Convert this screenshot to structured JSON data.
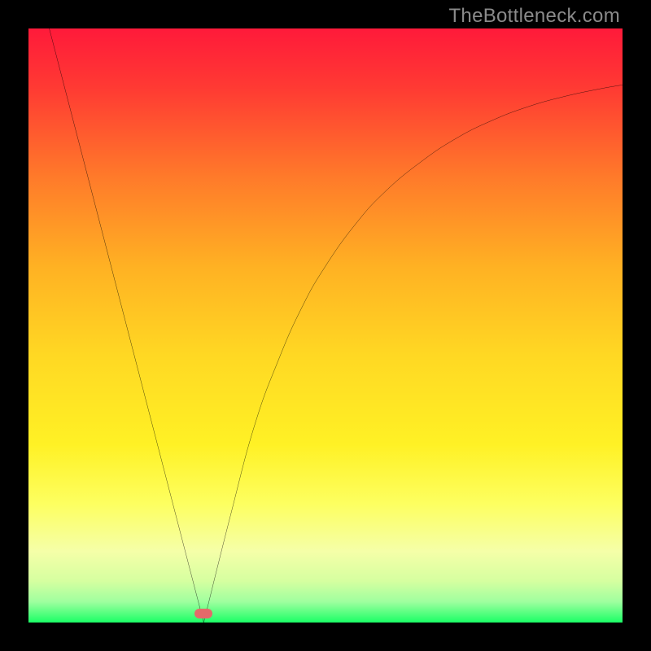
{
  "watermark": "TheBottleneck.com",
  "marker_color": "#e46a6a",
  "chart_data": {
    "type": "line",
    "title": "",
    "xlabel": "",
    "ylabel": "",
    "xlim": [
      0,
      100
    ],
    "ylim": [
      0,
      100
    ],
    "grid": false,
    "legend": false,
    "gradient_stops": [
      {
        "pos": 0.0,
        "color": "#ff1a3a"
      },
      {
        "pos": 0.1,
        "color": "#ff3a33"
      },
      {
        "pos": 0.25,
        "color": "#ff7a2a"
      },
      {
        "pos": 0.4,
        "color": "#ffb123"
      },
      {
        "pos": 0.55,
        "color": "#ffd823"
      },
      {
        "pos": 0.7,
        "color": "#fff125"
      },
      {
        "pos": 0.8,
        "color": "#fdff60"
      },
      {
        "pos": 0.88,
        "color": "#f5ffa8"
      },
      {
        "pos": 0.93,
        "color": "#d6ffa0"
      },
      {
        "pos": 0.965,
        "color": "#9fff9f"
      },
      {
        "pos": 1.0,
        "color": "#1bff66"
      }
    ],
    "series": [
      {
        "name": "curve-left",
        "x": [
          3.5,
          29.5
        ],
        "y": [
          100,
          0
        ],
        "style": "line"
      },
      {
        "name": "curve-right",
        "x": [
          29.5,
          34,
          38,
          42,
          46,
          50,
          55,
          60,
          66,
          72,
          78,
          84,
          90,
          96,
          100
        ],
        "y": [
          0,
          18,
          33,
          44,
          53,
          60,
          67,
          72.5,
          77.5,
          81.5,
          84.5,
          86.8,
          88.5,
          89.8,
          90.5
        ],
        "style": "curve"
      }
    ],
    "points": [
      {
        "name": "optimum-marker",
        "x": 29.5,
        "y": 1.5
      }
    ]
  }
}
